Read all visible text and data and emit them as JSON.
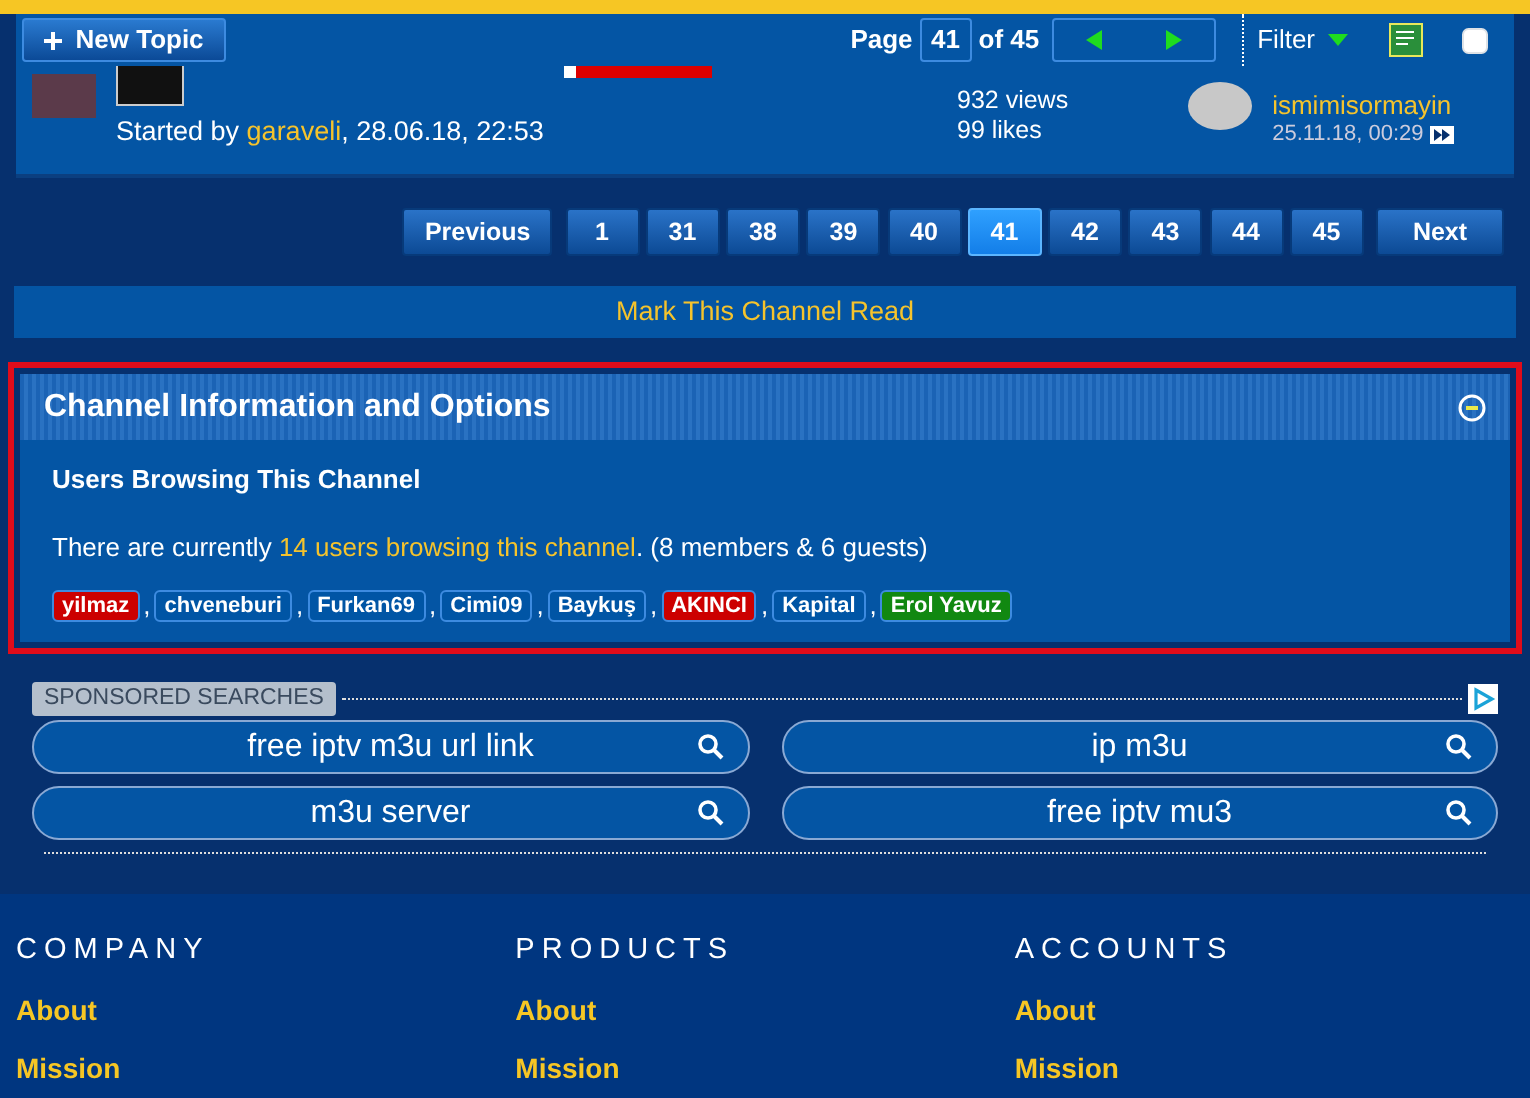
{
  "toolbar": {
    "new_topic": "New Topic",
    "page_label": "Page",
    "page_number": "41",
    "page_of": "of 45",
    "filter": "Filter",
    "select_all_checked": false
  },
  "topic": {
    "started_prefix": "Started by",
    "author": "garaveli",
    "date": ", 28.06.18, 22:53",
    "views": "932 views",
    "likes": "99 likes",
    "last_poster": "ismimisormayin",
    "last_date": "25.11.18, 00:29"
  },
  "pagination": [
    {
      "label": "Previous",
      "selected": false
    },
    {
      "label": "1",
      "selected": false
    },
    {
      "label": "31",
      "selected": false
    },
    {
      "label": "38",
      "selected": false
    },
    {
      "label": "39",
      "selected": false
    },
    {
      "label": "40",
      "selected": false
    },
    {
      "label": "41",
      "selected": true
    },
    {
      "label": "42",
      "selected": false
    },
    {
      "label": "43",
      "selected": false
    },
    {
      "label": "44",
      "selected": false
    },
    {
      "label": "45",
      "selected": false
    },
    {
      "label": "Next",
      "selected": false
    }
  ],
  "mark_read": "Mark This Channel Read",
  "info_panel": {
    "title": "Channel Information and Options",
    "heading": "Users Browsing This Channel",
    "text_before": "There are currently",
    "link": "14 users browsing this channel",
    "text_after": ". (8 members & 6 guests)",
    "separator": ",",
    "users": [
      {
        "name": "yilmaz",
        "color": "#cc0000"
      },
      {
        "name": "chveneburi",
        "color": "#0055a5"
      },
      {
        "name": "Furkan69",
        "color": "#0055a5"
      },
      {
        "name": "Cimi09",
        "color": "#0055a5"
      },
      {
        "name": "Baykuş",
        "color": "#0055a5"
      },
      {
        "name": "AKINCI",
        "color": "#cc0000"
      },
      {
        "name": "Kapital",
        "color": "#0055a5"
      },
      {
        "name": "Erol Yavuz",
        "color": "#118811"
      }
    ]
  },
  "sponsored": {
    "label": "SPONSORED SEARCHES",
    "searches": [
      "free iptv m3u url link",
      "ip m3u",
      "m3u server",
      "free iptv mu3"
    ]
  },
  "footer": [
    {
      "heading": "COMPANY",
      "links": [
        "About",
        "Mission"
      ]
    },
    {
      "heading": "PRODUCTS",
      "links": [
        "About",
        "Mission"
      ]
    },
    {
      "heading": "ACCOUNTS",
      "links": [
        "About",
        "Mission"
      ]
    }
  ]
}
